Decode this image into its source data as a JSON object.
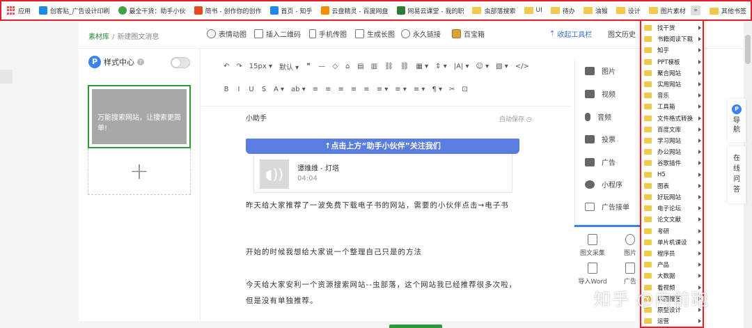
{
  "bookmarks_bar": {
    "items": [
      {
        "label": "应用",
        "icon": "apps-grid-icon",
        "color": "#e55353"
      },
      {
        "label": "创客贴_广告设计印刷",
        "icon": "chuangketie-icon",
        "color": "#1e88e5"
      },
      {
        "label": "最全干货：助手小伙",
        "icon": "wechat-icon",
        "color": "#43a047"
      },
      {
        "label": "简书 - 创作你的创作",
        "icon": "jianshu-icon",
        "color": "#e64a19"
      },
      {
        "label": "首页 - 知乎",
        "icon": "zhihu-icon",
        "color": "#1e88e5"
      },
      {
        "label": "云盘精灵 - 百度网盘",
        "icon": "yunpan-icon",
        "color": "#fb8c00"
      },
      {
        "label": "网易云课堂 - 我的职",
        "icon": "netease-icon",
        "color": "#2e7d32"
      },
      {
        "label": "虫部落搜索",
        "icon": "folder-icon",
        "color": "#f2c94c"
      },
      {
        "label": "UI",
        "icon": "folder-icon",
        "color": "#f2c94c"
      },
      {
        "label": "待办",
        "icon": "folder-icon",
        "color": "#f2c94c"
      },
      {
        "label": "油猴",
        "icon": "folder-icon",
        "color": "#f2c94c"
      },
      {
        "label": "设计",
        "icon": "folder-icon",
        "color": "#f2c94c"
      },
      {
        "label": "图片素材",
        "icon": "folder-icon",
        "color": "#f2c94c"
      }
    ],
    "more_label": "»",
    "other_label": "其他书签"
  },
  "editor": {
    "breadcrumb": {
      "root": "素材库",
      "separator": "/",
      "current": "新建图文消息"
    },
    "toolbar": [
      {
        "label": "表情动图",
        "icon": "sticker-icon"
      },
      {
        "label": "插入二维码",
        "icon": "qrcode-icon"
      },
      {
        "label": "手机传图",
        "icon": "phone-icon"
      },
      {
        "label": "生成长图",
        "icon": "longimage-icon"
      },
      {
        "label": "永久链接",
        "icon": "link-icon"
      },
      {
        "label": "百宝箱",
        "icon": "treasure-box-icon"
      },
      {
        "label": "收起工具栏",
        "icon": "collapse-icon"
      },
      {
        "label": "图文历史"
      }
    ]
  },
  "style_center": {
    "title": "样式中心",
    "badge": "P",
    "help": "?",
    "template_text": "万能搜索网站，让搜索更简单!",
    "add_label": "+"
  },
  "format_toolbar": {
    "row1": [
      "↶",
      "↷",
      "15px ▾",
      "默认 ▾",
      "❞",
      "—",
      "◇",
      "⌂",
      "▤",
      "▥",
      "⛓",
      "⛓",
      "▦ ▾",
      "⇕ ▾",
      "|A| ▾",
      "☺ ▾",
      "▧ ▾",
      "</>"
    ],
    "row2": [
      "B",
      "I",
      "U",
      "S",
      "A ▾",
      "ab ▾",
      "≡",
      "≡",
      "≡",
      "≡",
      "≡",
      "≡ ▾",
      "≡ ▾",
      "≡ ▾",
      "¶ ▾",
      "✂",
      "⊡"
    ]
  },
  "article": {
    "author": "小助手",
    "autosave": "自动保存 ◷",
    "banner": "↑点击上方“助手小伙伴”关注我们",
    "audio": {
      "title": "谭维维 - 灯塔",
      "duration": "04:04"
    },
    "paragraphs": [
      "昨天给大家推荐了一波免费下载电子书的网站，需要的小伙伴点击→电子书",
      "开始的时候我想给大家说一个整理自己只是的方法",
      "今天给大家安利一个资源搜索网站--虫部落，这个网站我已经推荐很多次啦，但是没有单独推荐。"
    ]
  },
  "insert_panel": {
    "items": [
      {
        "label": "图片",
        "icon": "image-icon"
      },
      {
        "label": "视频",
        "icon": "video-icon"
      },
      {
        "label": "音频",
        "icon": "audio-icon"
      },
      {
        "label": "投票",
        "icon": "vote-icon"
      },
      {
        "label": "广告",
        "icon": "ad-icon"
      },
      {
        "label": "小程序",
        "icon": "miniprogram-icon"
      },
      {
        "label": "广告接单",
        "icon": "ad-order-icon"
      }
    ]
  },
  "tool_grid": {
    "items": [
      {
        "label": "图文采集",
        "icon": "collect-icon"
      },
      {
        "label": "图片",
        "icon": "image-icon"
      },
      {
        "label": "导入Word",
        "icon": "word-icon"
      },
      {
        "label": "广告",
        "icon": "ad-icon"
      }
    ]
  },
  "bookmark_dropdown": {
    "items": [
      "找干货",
      "书籍阅读下载",
      "知乎",
      "PPT模板",
      "聚合网站",
      "实用网站",
      "音乐",
      "工具箱",
      "文件格式转换",
      "百度文库",
      "学习网站",
      "办公网站",
      "谷歌插件",
      "H5",
      "图表",
      "好玩网站",
      "电子论坛",
      "论文文献",
      "考研",
      "单片机课设",
      "程序员",
      "产品",
      "大数据",
      "看视频",
      "以图搜图",
      "原型设计",
      "运营"
    ]
  },
  "side_widgets": {
    "guide_badge": "P",
    "guide": "导航",
    "online": "在线问答"
  },
  "watermark": "知乎 @向前跑",
  "colors": {
    "accent_red": "#e0202a",
    "green": "#2a9a3a",
    "blue": "#3b82f6",
    "banner_blue": "#5a7de0",
    "folder_yellow": "#f2c94c"
  }
}
